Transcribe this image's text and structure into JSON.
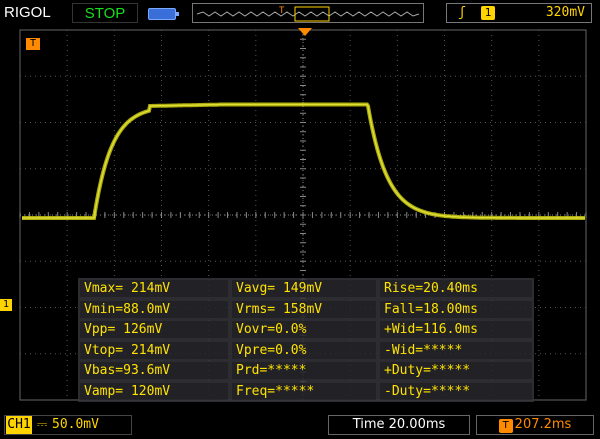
{
  "header": {
    "brand": "RIGOL",
    "run_state": "STOP",
    "trigger_marker": "T",
    "trigger_edge_icon": "rising-edge-icon",
    "trigger_source": "1",
    "trigger_level": "320mV"
  },
  "screen": {
    "channel_marker": "1",
    "time_marker": "T",
    "trace_color": "#c8c812",
    "waveform": {
      "baseline_level": 0.0,
      "high_level": 214,
      "description_points": "rise then flat then fall"
    }
  },
  "measurements": [
    [
      "Vmax= 214mV",
      "Vavg= 149mV",
      "Rise=20.40ms"
    ],
    [
      "Vmin=88.0mV",
      "Vrms= 158mV",
      "Fall=18.00ms"
    ],
    [
      "Vpp= 126mV",
      "Vovr=0.0%",
      "+Wid=116.0ms"
    ],
    [
      "Vtop= 214mV",
      "Vpre=0.0%",
      "-Wid=*****"
    ],
    [
      "Vbas=93.6mV",
      "Prd=*****",
      "+Duty=*****"
    ],
    [
      "Vamp= 120mV",
      "Freq=*****",
      "-Duty=*****"
    ]
  ],
  "footer": {
    "channel_badge": "CH1",
    "coupling_icon": "dc-coupling-icon",
    "volts_div": "50.0mV",
    "timebase": "Time 20.00ms",
    "trigger_icon": "T",
    "trigger_delay": "207.2ms"
  },
  "colors": {
    "accent_yellow": "#ffd400",
    "stop_green": "#18e018",
    "trigger_orange": "#ff8a00",
    "grid": "#777777"
  }
}
